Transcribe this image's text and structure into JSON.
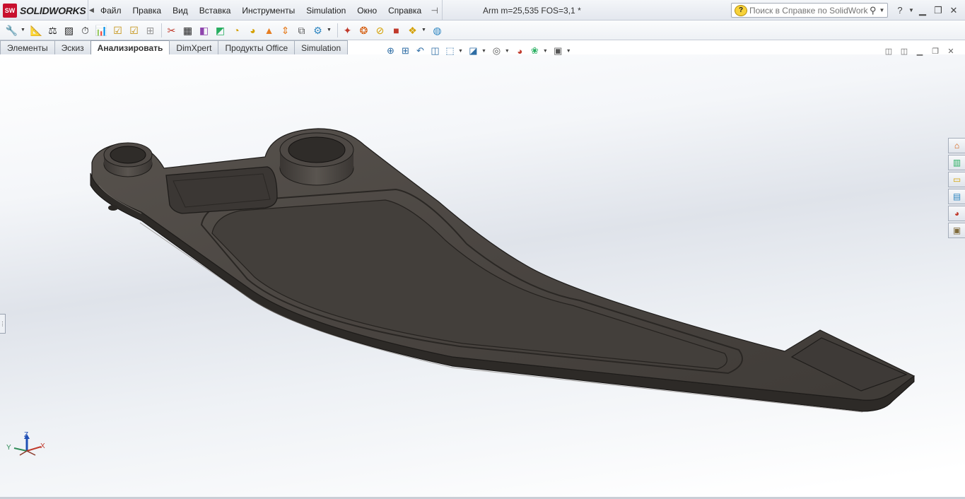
{
  "app": {
    "logo_mark": "SW",
    "logo_text": "SOLIDWORKS",
    "document_title": "Arm m=25,535 FOS=3,1 *"
  },
  "menu": {
    "items": [
      "Файл",
      "Правка",
      "Вид",
      "Вставка",
      "Инструменты",
      "Simulation",
      "Окно",
      "Справка"
    ]
  },
  "help_search": {
    "placeholder": "Поиск в Справке по SolidWorks"
  },
  "tabs": [
    {
      "label": "Элементы",
      "active": false
    },
    {
      "label": "Эскиз",
      "active": false
    },
    {
      "label": "Анализировать",
      "active": true
    },
    {
      "label": "DimXpert",
      "active": false
    },
    {
      "label": "Продукты Office",
      "active": false
    },
    {
      "label": "Simulation",
      "active": false
    }
  ],
  "triad": {
    "x": "X",
    "y": "Y",
    "z": "Z"
  },
  "colors": {
    "model": "#4a4541",
    "model_edge": "#1e1c1a",
    "brand_red": "#c8102e",
    "triad_x": "#c0392b",
    "triad_y": "#2e8b57",
    "triad_z": "#1f4fb5"
  }
}
